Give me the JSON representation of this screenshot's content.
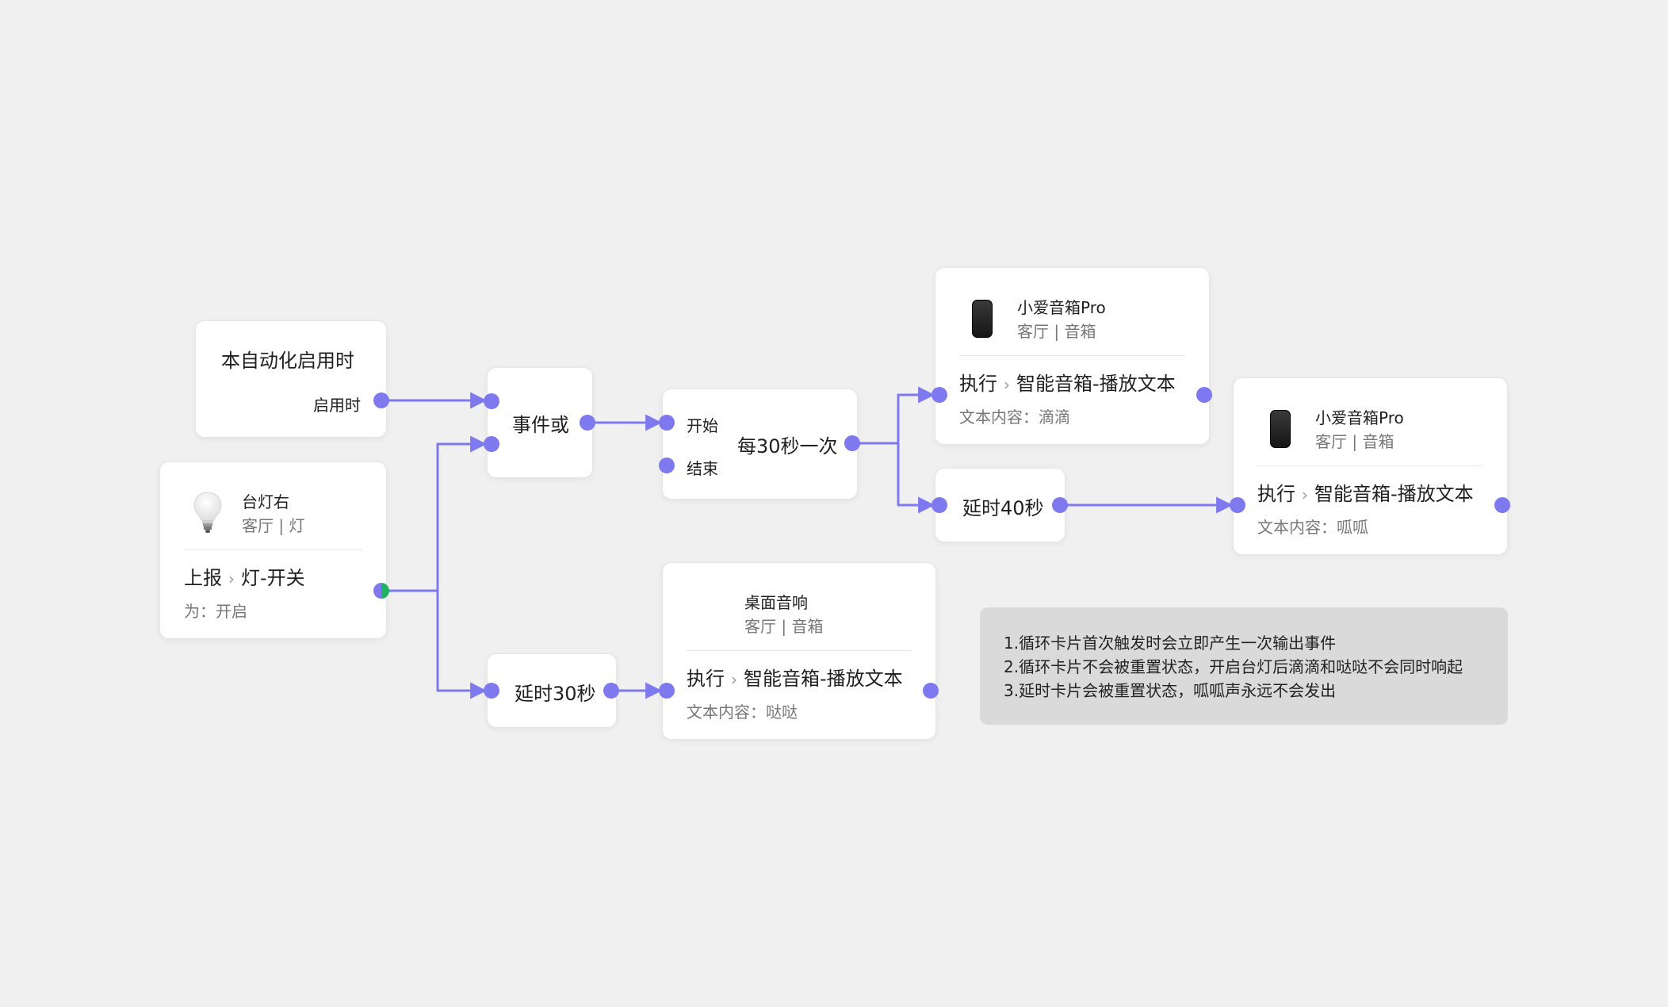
{
  "colors": {
    "accent": "#7f79ef",
    "green": "#22b063",
    "card_bg": "#ffffff",
    "canvas_bg": "#f0f0f0",
    "note_bg": "#dadada"
  },
  "icons": {
    "bulb": "light-bulb-icon",
    "speaker": "smart-speaker-icon"
  },
  "nodes": {
    "auto_enabled": {
      "title": "本自动化启用时",
      "output_label": "启用时"
    },
    "lamp": {
      "name": "台灯右",
      "location": "客厅 | 灯",
      "action": "上报",
      "target": "灯-开关",
      "value": "为：开启"
    },
    "event_or": {
      "title": "事件或"
    },
    "loop": {
      "title": "每30秒一次",
      "in_start": "开始",
      "in_end": "结束"
    },
    "speaker_pro_1": {
      "name": "小爱音箱Pro",
      "location": "客厅 | 音箱",
      "action": "执行",
      "target": "智能音箱-播放文本",
      "content": "文本内容：滴滴"
    },
    "delay_40": {
      "title": "延时40秒"
    },
    "speaker_pro_2": {
      "name": "小爱音箱Pro",
      "location": "客厅 | 音箱",
      "action": "执行",
      "target": "智能音箱-播放文本",
      "content": "文本内容：呱呱"
    },
    "delay_30": {
      "title": "延时30秒"
    },
    "desk_speaker": {
      "name": "桌面音响",
      "location": "客厅 | 音箱",
      "action": "执行",
      "target": "智能音箱-播放文本",
      "content": "文本内容：哒哒"
    }
  },
  "note": {
    "lines": [
      "1.循环卡片首次触发时会立即产生一次输出事件",
      "2.循环卡片不会被重置状态，开启台灯后滴滴和哒哒不会同时响起",
      "3.延时卡片会被重置状态，呱呱声永远不会发出"
    ]
  }
}
